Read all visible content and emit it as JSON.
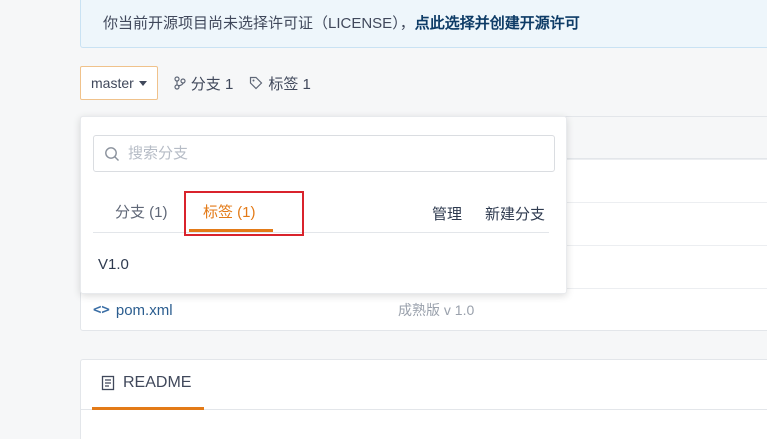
{
  "license_notice": {
    "text": "你当前开源项目尚未选择许可证（LICENSE），",
    "link": "点此选择并创建开源许可"
  },
  "toolbar": {
    "branch": "master",
    "branches_stat": "分支 1",
    "tags_stat": "标签 1"
  },
  "dropdown": {
    "search_placeholder": "搜索分支",
    "tabs": {
      "branches": "分支 (1)",
      "tags": "标签 (1)"
    },
    "actions": {
      "manage": "管理",
      "new_branch": "新建分支"
    },
    "tags": [
      "V1.0"
    ]
  },
  "files": [
    {
      "name": "pom.xml",
      "commit": "成熟版 v 1.0"
    }
  ],
  "readme": {
    "title": "README"
  },
  "colors": {
    "accent": "#e37a17",
    "highlight": "#d9232c",
    "link": "#2b5d8f"
  }
}
